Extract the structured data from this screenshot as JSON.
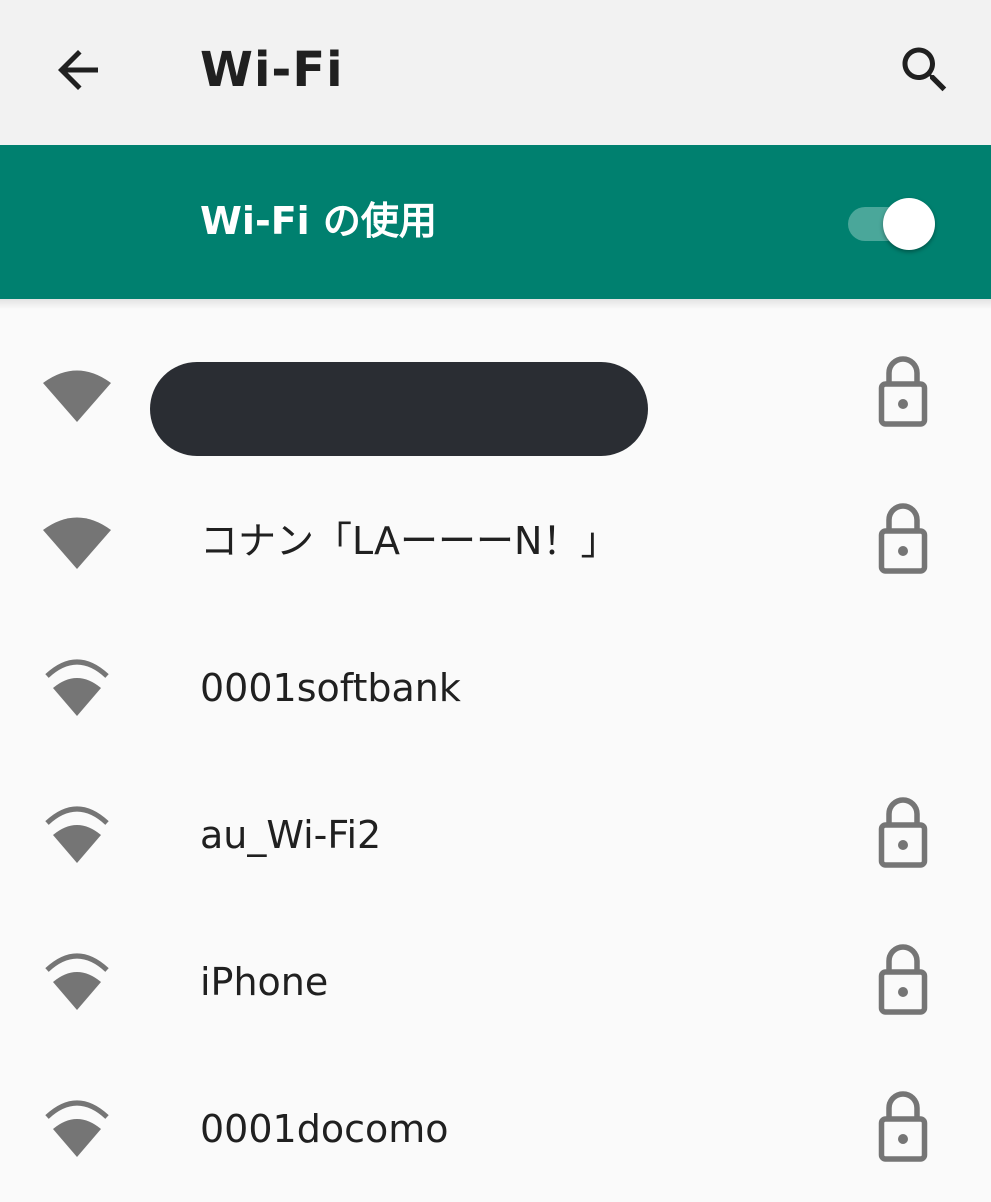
{
  "appbar": {
    "title": "Wi-Fi",
    "back_icon": "arrow-back-icon",
    "search_icon": "search-icon"
  },
  "master_switch": {
    "label": "Wi-Fi の使用",
    "state": "on"
  },
  "networks": [
    {
      "ssid": "",
      "redacted": true,
      "signal": "3-of-4",
      "locked": true
    },
    {
      "ssid": "コナン「LAーーーN！」",
      "signal": "3-of-4",
      "locked": true
    },
    {
      "ssid": "0001softbank",
      "signal": "2-of-4",
      "locked": false
    },
    {
      "ssid": "au_Wi-Fi2",
      "signal": "2-of-4",
      "locked": true
    },
    {
      "ssid": "iPhone",
      "signal": "2-of-4",
      "locked": true
    },
    {
      "ssid": "0001docomo",
      "signal": "2-of-4",
      "locked": true
    }
  ],
  "colors": {
    "appbar_bg": "#f2f2f2",
    "accent": "#00806f",
    "icon_gray": "#757575",
    "text": "#202020",
    "redaction": "#2a2d33"
  }
}
